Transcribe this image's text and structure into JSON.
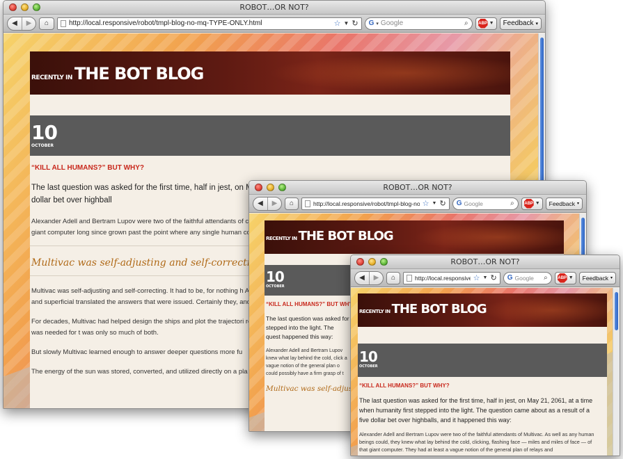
{
  "browser": {
    "window_title": "ROBOT…OR NOT?",
    "url_full": "http://local.responsive/robot/tmpl-blog-no-mq-TYPE-ONLY.html",
    "url_medium": "http://local.responsive/robot/tmpl-blog-no-mq-TY",
    "url_short": "http://local.responsive/robot/t",
    "search_placeholder": "Google",
    "feedback_label": "Feedback",
    "abp_label": "ABP"
  },
  "blog": {
    "hero_small": "RECENTLY IN",
    "hero_title": "THE BOT BLOG",
    "date_day": "10",
    "date_month": "OCTOBER",
    "post_title": "“KILL ALL HUMANS?” BUT WHY?",
    "w1_lead": "The last question was asked for the first time, half in jest, on Ma question came about as a result of a five dollar bet over highball",
    "w1_p1": "Alexander Adell and Bertram Lupov were two of the faithful attendants of clicking, flashing face — miles and miles of face — of that giant computer long since grown past the point where any single human could possibly h",
    "pull_quote": "Multivac was self-adjusting and self-correcting.",
    "w1_p2": "Multivac was self-adjusting and self-correcting. It had to be, for nothing h Adell and Lupov attended the monstrous giant only lightly and superficial translated the answers that were issued. Certainly they, and all others lik",
    "w1_p3": "For decades, Multivac had helped design the ships and plot the trajectori resources could not support the ships. Too much energy was needed for t was only so much of both.",
    "w1_p4": "But slowly Multivac learned enough to answer deeper questions more fu",
    "w1_p5": "The energy of the sun was stored, converted, and utilized directly on a pla",
    "w2_lead": "The last question was asked for stepped into the light. The quest happened this way:",
    "w2_p1": "Alexander Adell and Bertram Lupov knew what lay behind the cold, click a vague notion of the general plan o could possibly have a firm grasp of t",
    "w2_pull": "Multivac was self-adjusting",
    "w3_lead": "The last question was asked for the first time, half in jest, on May 21, 2061, at a time when humanity first stepped into the light. The question came about as a result of a five dollar bet over highballs, and it happened this way:",
    "w3_p1": "Alexander Adell and Bertram Lupov were two of the faithful attendants of Multivac. As well as any human beings could, they knew what lay behind the cold, clicking, flashing face — miles and miles of face — of that giant computer. They had at least a vague notion of the general plan of relays and"
  },
  "colors": {
    "hero_dark": "#3b100a",
    "post_title_red": "#c8281c",
    "pull_orange": "#b06a18",
    "date_gray": "#5a5a5a"
  }
}
